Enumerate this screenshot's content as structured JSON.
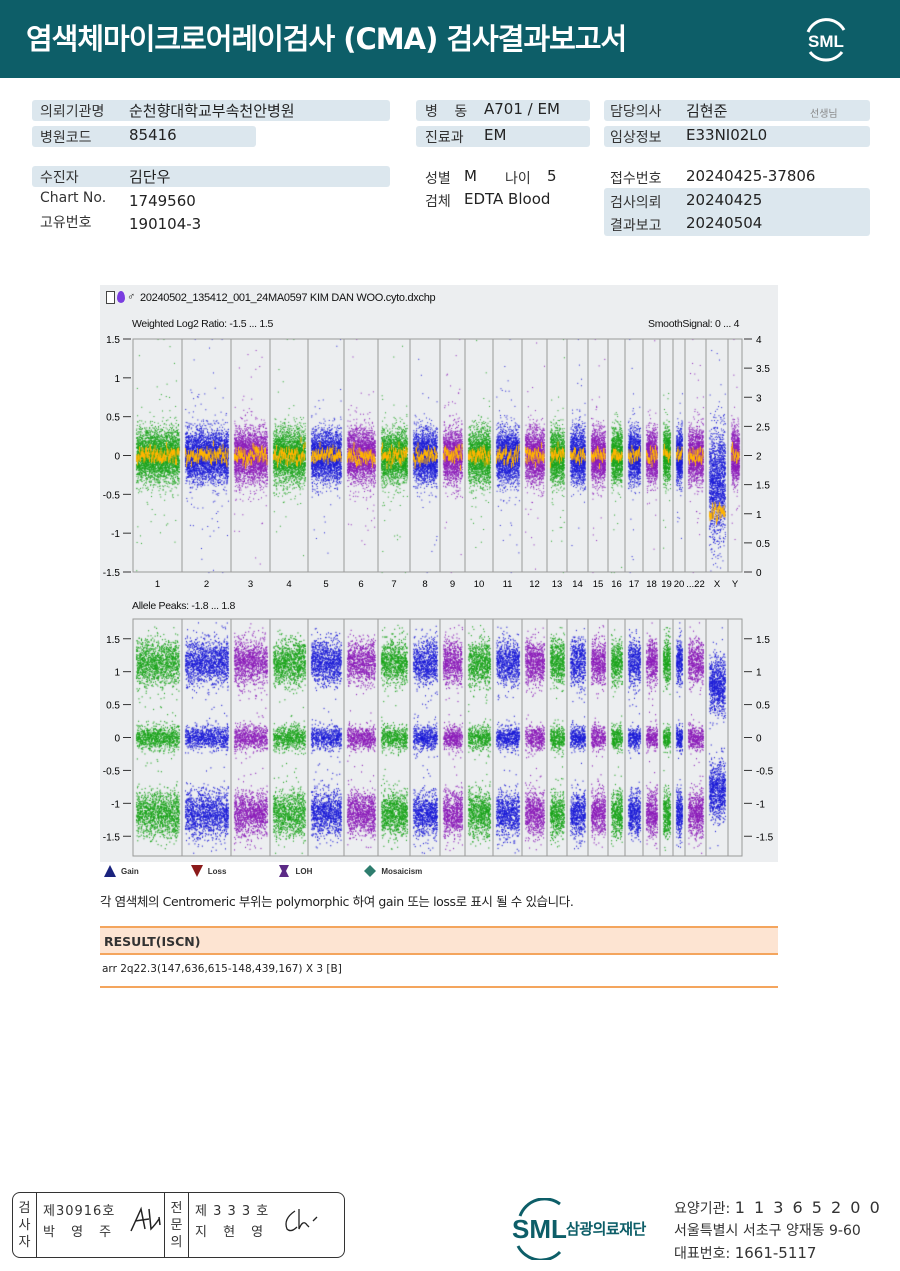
{
  "header": {
    "title": "염색체마이크로어레이검사 (CMA) 검사결과보고서",
    "logo": "SML",
    "bg_color": "#0d5e68"
  },
  "info": {
    "institution": {
      "label": "의뢰기관명",
      "value": "순천향대학교부속천안병원"
    },
    "hospital_code": {
      "label": "병원코드",
      "value": "85416"
    },
    "patient": {
      "label": "수진자",
      "value": "김단우"
    },
    "chart_no": {
      "label": "Chart No.",
      "value": "1749560"
    },
    "unique_no": {
      "label": "고유번호",
      "value": "190104-3"
    },
    "ward": {
      "label": "병 동",
      "value": "A701 / EM"
    },
    "department": {
      "label": "진료과",
      "value": "EM"
    },
    "sex": {
      "label": "성별",
      "value": "M"
    },
    "age": {
      "label": "나이",
      "value": "5"
    },
    "specimen": {
      "label": "검체",
      "value": "EDTA Blood"
    },
    "doctor": {
      "label": "담당의사",
      "value": "김현준",
      "suffix": "선생님"
    },
    "clinical": {
      "label": "임상정보",
      "value": "E33NI02L0"
    },
    "receipt_no": {
      "label": "접수번호",
      "value": "20240425-37806"
    },
    "request_date": {
      "label": "검사의뢰",
      "value": "20240425"
    },
    "report_date": {
      "label": "결과보고",
      "value": "20240504"
    }
  },
  "figure": {
    "file": "20240502_135412_001_24MA0597 KIM DAN WOO.cyto.dxchp",
    "top_label_left": "Weighted Log2 Ratio: -1.5 ... 1.5",
    "top_label_right": "SmoothSignal: 0 ... 4",
    "bottom_label": "Allele Peaks: -1.8 ... 1.8",
    "top_left_ticks": [
      "1.5",
      "1",
      "0.5",
      "0",
      "-0.5",
      "-1",
      "-1.5"
    ],
    "top_right_ticks": [
      "4",
      "3.5",
      "3",
      "2.5",
      "2",
      "1.5",
      "1",
      "0.5",
      "0"
    ],
    "bottom_ticks": [
      "1.5",
      "1",
      "0.5",
      "0",
      "-0.5",
      "-1",
      "-1.5"
    ],
    "chromosomes": [
      "1",
      "2",
      "3",
      "4",
      "5",
      "6",
      "7",
      "8",
      "9",
      "10",
      "11",
      "12",
      "13",
      "14",
      "15",
      "16",
      "17",
      "18",
      "19",
      "20",
      "...22",
      "X",
      "Y"
    ],
    "colors": {
      "green": "#1aa31a",
      "blue": "#1a1ad6",
      "purple": "#8a1ab8",
      "smooth": "#ffb400"
    }
  },
  "legend": [
    {
      "icon": "gain-triangle-up-icon",
      "label": "Gain",
      "color": "#1a237e"
    },
    {
      "icon": "loss-triangle-down-icon",
      "label": "Loss",
      "color": "#8b1a1a"
    },
    {
      "icon": "loh-icon",
      "label": "LOH",
      "color": "#5b2a86"
    },
    {
      "icon": "mosaicism-diamond-icon",
      "label": "Mosaicism",
      "color": "#2e7d6e"
    }
  ],
  "note": "각 염색체의 Centromeric 부위는 polymorphic 하여 gain 또는 loss로 표시 될 수 있습니다.",
  "result": {
    "header": "RESULT(ISCN)",
    "value": "arr 2q22.3(147,636,615-148,439,167) X 3 [B]"
  },
  "footer": {
    "examiner": {
      "title": "검사자",
      "no": "제30916호",
      "name": "박 영 주"
    },
    "specialist": {
      "title": "전문의",
      "no": "제 3 3 3 호",
      "name": "지 현 영"
    },
    "org": "삼광의료재단",
    "org_logo": "SML",
    "care_label": "요양기관:",
    "care_no": "1 1 3 6 5 2 0 0",
    "address": "서울특별시 서초구 양재동 9-60",
    "phone_label": "대표번호:",
    "phone": "1661-5117"
  }
}
